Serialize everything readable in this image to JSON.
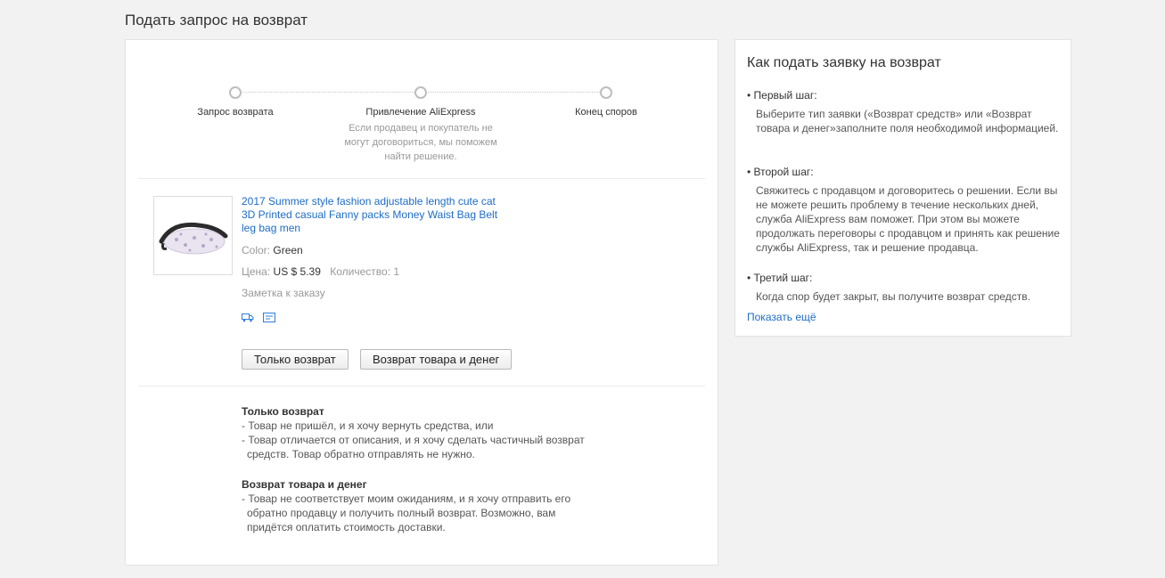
{
  "page": {
    "title": "Подать запрос на возврат"
  },
  "progress": {
    "steps": [
      {
        "label": "Запрос возврата",
        "desc": ""
      },
      {
        "label": "Привлечение AliExpress",
        "desc": "Если продавец и покупатель не могут договориться, мы поможем найти решение."
      },
      {
        "label": "Конец споров",
        "desc": ""
      }
    ]
  },
  "product": {
    "title": "2017 Summer style fashion adjustable length cute cat 3D Printed casual Fanny packs Money Waist Bag Belt leg bag men",
    "color_label": "Color:",
    "color_value": "Green",
    "price_label": "Цена:",
    "price_value": "US $ 5.39",
    "qty_label": "Количество:",
    "qty_value": "1",
    "note_label": "Заметка к заказу",
    "icons": [
      "delivery-truck-icon",
      "order-card-icon"
    ]
  },
  "actions": {
    "refund_only": "Только возврат",
    "return_and_refund": "Возврат товара и денег"
  },
  "info": {
    "refund_only": {
      "title": "Только возврат",
      "lines": [
        "- Товар не пришёл, и я хочу вернуть средства, или",
        "- Товар отличается от описания, и я хочу сделать частичный возврат средств. Товар обратно отправлять не нужно."
      ]
    },
    "return_and_refund": {
      "title": "Возврат товара и денег",
      "lines": [
        "- Товар не соответствует моим ожиданиям, и я хочу отправить его обратно продавцу и получить полный возврат. Возможно, вам придётся оплатить стоимость доставки."
      ]
    }
  },
  "sidebar": {
    "title": "Как подать заявку на возврат",
    "steps": [
      {
        "title": "• Первый шаг:",
        "text": "Выберите тип заявки («Возврат средств» или «Возврат товара и денег»заполните поля необходимой информацией."
      },
      {
        "title": "• Второй шаг:",
        "text": "Свяжитесь с продавцом и договоритесь о решении. Если вы не можете решить проблему в течение нескольких дней, служба AliExpress вам поможет. При этом вы можете продолжать переговоры с продавцом и принять как решение службы AliExpress, так и решение продавца."
      },
      {
        "title": "• Третий шаг:",
        "text": "Когда спор будет закрыт, вы получите возврат средств."
      }
    ],
    "show_more": "Показать ещё"
  },
  "colors": {
    "link": "#1d6cc6",
    "background": "#f2f2f2"
  }
}
